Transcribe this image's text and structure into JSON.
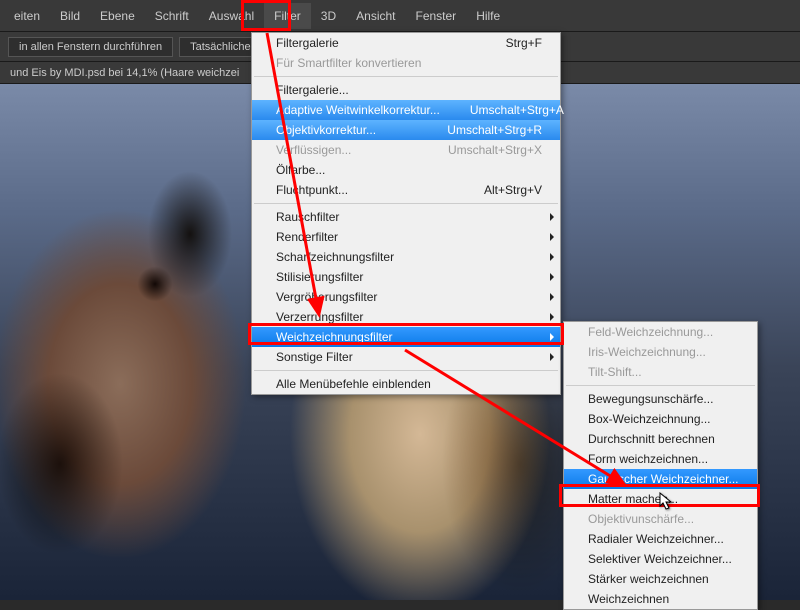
{
  "menubar": {
    "items": [
      "eiten",
      "Bild",
      "Ebene",
      "Schrift",
      "Auswahl",
      "Filter",
      "3D",
      "Ansicht",
      "Fenster",
      "Hilfe"
    ],
    "active_index": 5
  },
  "toolbar": {
    "btn1": "in allen Fenstern durchführen",
    "btn2": "Tatsächliche Pi"
  },
  "doc": {
    "title": "und Eis by MDI.psd bei 14,1%  (Haare weichzei"
  },
  "filter_menu": {
    "items": [
      {
        "label": "Filtergalerie",
        "shortcut": "Strg+F",
        "type": "item"
      },
      {
        "label": "Für Smartfilter konvertieren",
        "type": "disabled"
      },
      {
        "type": "sep"
      },
      {
        "label": "Filtergalerie...",
        "type": "item"
      },
      {
        "label": "Adaptive Weitwinkelkorrektur...",
        "shortcut": "Umschalt+Strg+A",
        "type": "hover"
      },
      {
        "label": "Objektivkorrektur...",
        "shortcut": "Umschalt+Strg+R",
        "type": "hover"
      },
      {
        "label": "Verflüssigen...",
        "shortcut": "Umschalt+Strg+X",
        "type": "disabled"
      },
      {
        "label": "Ölfarbe...",
        "type": "item"
      },
      {
        "label": "Fluchtpunkt...",
        "shortcut": "Alt+Strg+V",
        "type": "item"
      },
      {
        "type": "sep"
      },
      {
        "label": "Rauschfilter",
        "type": "sub"
      },
      {
        "label": "Renderfilter",
        "type": "sub"
      },
      {
        "label": "Scharfzeichnungsfilter",
        "type": "sub"
      },
      {
        "label": "Stilisierungsfilter",
        "type": "sub"
      },
      {
        "label": "Vergröberungsfilter",
        "type": "sub"
      },
      {
        "label": "Verzerrungsfilter",
        "type": "sub"
      },
      {
        "label": "Weichzeichnungsfilter",
        "type": "selected-sub"
      },
      {
        "label": "Sonstige Filter",
        "type": "sub"
      },
      {
        "type": "sep"
      },
      {
        "label": "Alle Menübefehle einblenden",
        "type": "item"
      }
    ]
  },
  "blur_submenu": {
    "items": [
      {
        "label": "Feld-Weichzeichnung...",
        "type": "disabled"
      },
      {
        "label": "Iris-Weichzeichnung...",
        "type": "disabled"
      },
      {
        "label": "Tilt-Shift...",
        "type": "disabled"
      },
      {
        "type": "sep"
      },
      {
        "label": "Bewegungsunschärfe...",
        "type": "item"
      },
      {
        "label": "Box-Weichzeichnung...",
        "type": "item"
      },
      {
        "label": "Durchschnitt berechnen",
        "type": "item"
      },
      {
        "label": "Form weichzeichnen...",
        "type": "item"
      },
      {
        "label": "Gaußscher Weichzeichner...",
        "type": "selected"
      },
      {
        "label": "Matter machen...",
        "type": "item"
      },
      {
        "label": "Objektivunschärfe...",
        "type": "disabled"
      },
      {
        "label": "Radialer Weichzeichner...",
        "type": "item"
      },
      {
        "label": "Selektiver Weichzeichner...",
        "type": "item"
      },
      {
        "label": "Stärker weichzeichnen",
        "type": "item"
      },
      {
        "label": "Weichzeichnen",
        "type": "item"
      }
    ]
  }
}
